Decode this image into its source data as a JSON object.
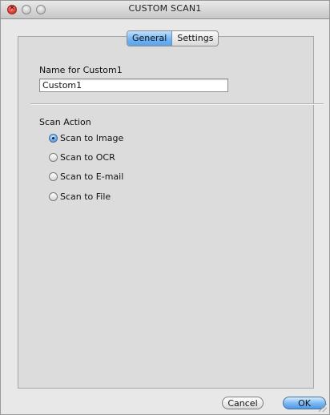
{
  "window": {
    "title": "CUSTOM SCAN1",
    "close_glyph": "×"
  },
  "tabs": [
    {
      "label": "General",
      "active": true
    },
    {
      "label": "Settings",
      "active": false
    }
  ],
  "general": {
    "name_label": "Name for Custom1",
    "name_value": "Custom1",
    "scan_action_label": "Scan Action",
    "scan_actions": [
      {
        "label": "Scan to Image",
        "selected": true
      },
      {
        "label": "Scan to OCR",
        "selected": false
      },
      {
        "label": "Scan to E-mail",
        "selected": false
      },
      {
        "label": "Scan to File",
        "selected": false
      }
    ]
  },
  "buttons": {
    "cancel_label": "Cancel",
    "ok_label": "OK"
  },
  "colors": {
    "accent": "#5aa4ec",
    "close_red": "#e0443a"
  }
}
